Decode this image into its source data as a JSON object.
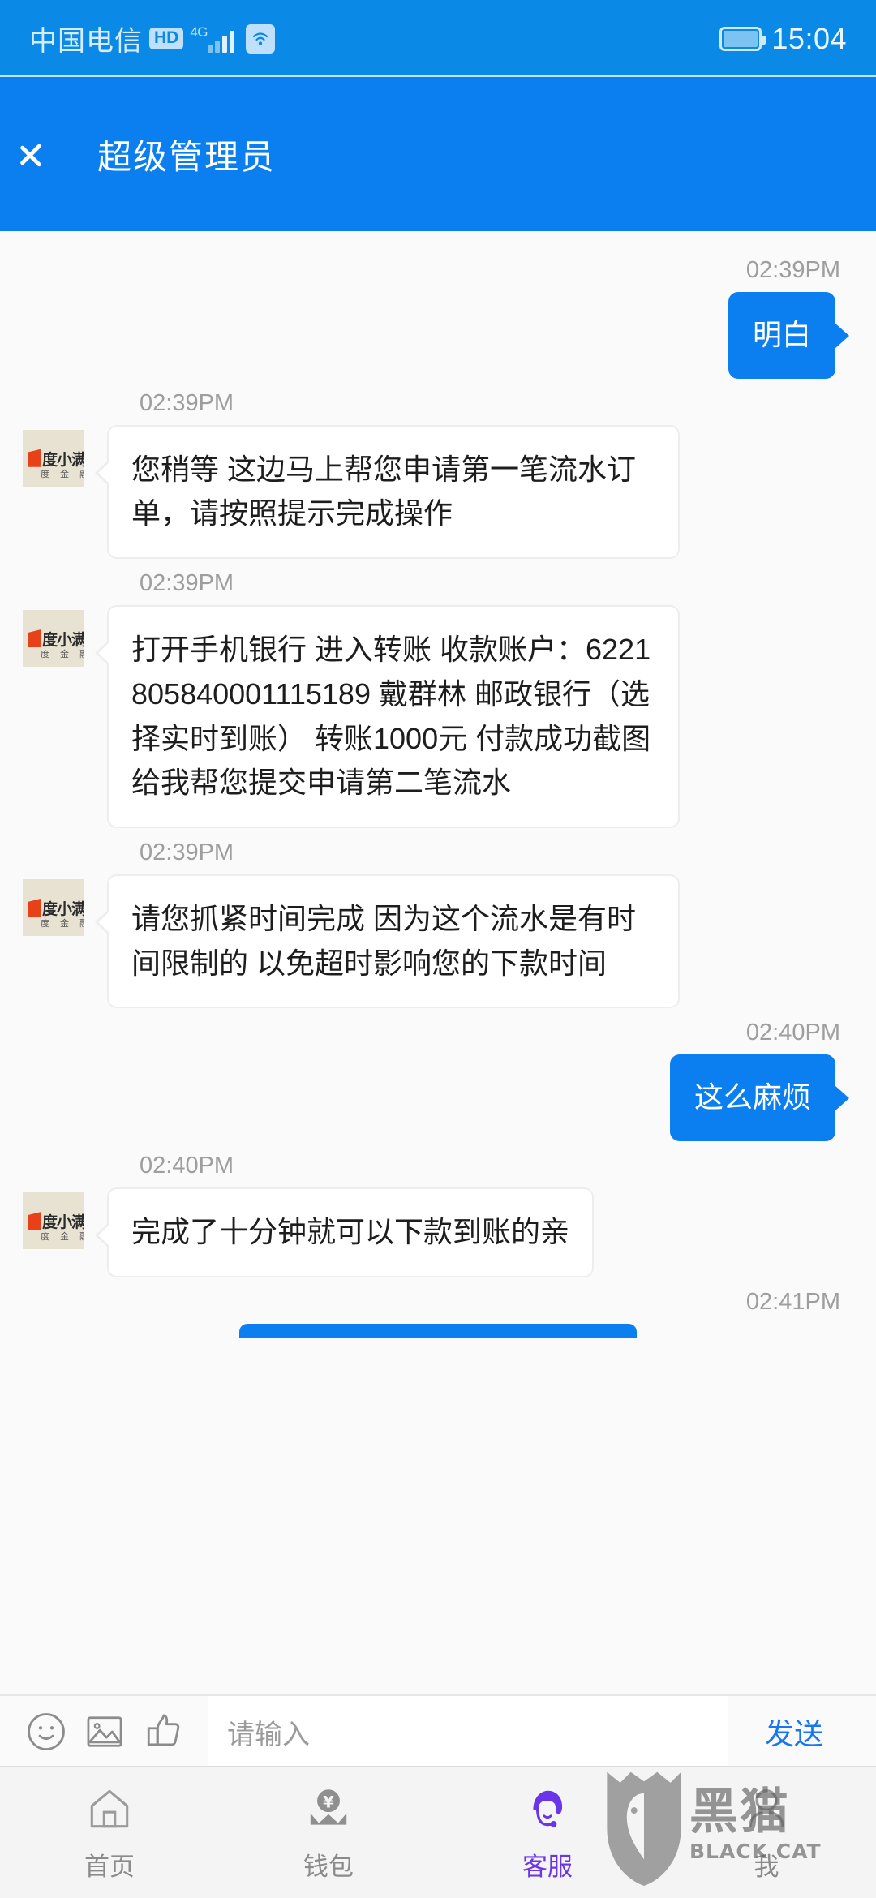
{
  "status_bar": {
    "carrier": "中国电信",
    "hd_badge": "HD",
    "network": "4G",
    "clock": "15:04"
  },
  "nav_bar": {
    "title": "超级管理员",
    "back_icon": "chevron-left-icon"
  },
  "theme": {
    "accent_blue": "#0b7ef0",
    "status_blue": "#0a8ae6",
    "incoming_bubble": "#ffffff",
    "outgoing_bubble": "#0b7ef0",
    "page_bg": "#fafafa",
    "active_tab": "#6a35e8"
  },
  "contact": {
    "avatar_logo_main": "度小满金融",
    "avatar_logo_sub": "度 金 融 服",
    "avatar_bg": "#e8e2d2"
  },
  "messages": [
    {
      "side": "out",
      "time": "02:39PM",
      "text": "明白"
    },
    {
      "side": "in",
      "time": "02:39PM",
      "text": "您稍等 这边马上帮您申请第一笔流水订单，请按照提示完成操作"
    },
    {
      "side": "in",
      "time": "02:39PM",
      "text": "打开手机银行 进入转账 收款账户：6221805840001115189 戴群林 邮政银行（选择实时到账） 转账1000元 付款成功截图给我帮您提交申请第二笔流水"
    },
    {
      "side": "in",
      "time": "02:39PM",
      "text": "请您抓紧时间完成 因为这个流水是有时间限制的 以免超时影响您的下款时间"
    },
    {
      "side": "out",
      "time": "02:40PM",
      "text": "这么麻烦"
    },
    {
      "side": "in",
      "time": "02:40PM",
      "text": "完成了十分钟就可以下款到账的亲"
    },
    {
      "side": "out",
      "time": "02:41PM",
      "text": ""
    }
  ],
  "input_bar": {
    "emoji_icon": "smiley-icon",
    "image_icon": "image-icon",
    "thumbs_icon": "thumbs-up-icon",
    "placeholder": "请输入",
    "value": "",
    "send_label": "发送"
  },
  "bottom_nav": {
    "items": [
      {
        "label": "首页",
        "icon": "home-icon",
        "active": false
      },
      {
        "label": "钱包",
        "icon": "wallet-yen-icon",
        "active": false
      },
      {
        "label": "客服",
        "icon": "headset-agent-icon",
        "active": true
      },
      {
        "label": "我",
        "icon": "person-icon",
        "active": false
      }
    ]
  },
  "watermark": {
    "cn": "黑猫",
    "en": "BLACK CAT",
    "icon": "black-cat-icon"
  }
}
